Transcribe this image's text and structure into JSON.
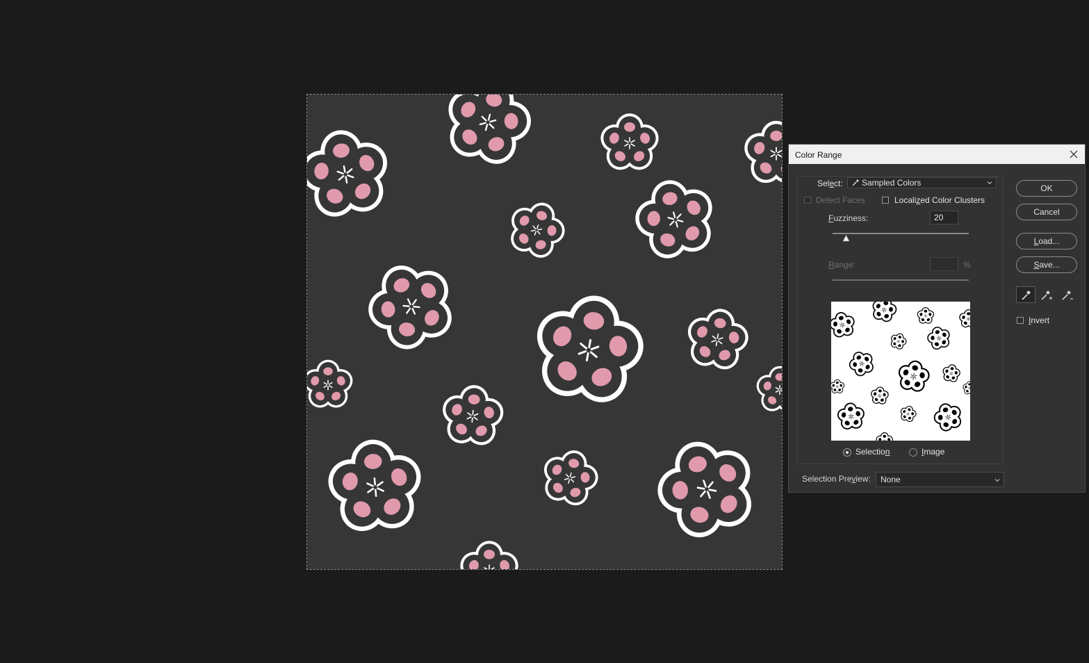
{
  "dialog": {
    "title": "Color Range",
    "select_label_pre": "Sel",
    "select_label_key": "e",
    "select_label_post": "ct:",
    "select_value": "Sampled Colors",
    "detect_faces": "Detect Faces",
    "localized_pre": "Locali",
    "localized_key": "z",
    "localized_post": "ed Color Clusters",
    "fuzziness_key": "F",
    "fuzziness_rest": "uzziness:",
    "fuzziness_value": "20",
    "range_key": "R",
    "range_rest": "ange:",
    "range_unit": "%",
    "radio_selection_pre": "Selectio",
    "radio_selection_key": "n",
    "radio_image_key": "I",
    "radio_image_rest": "mage",
    "preview_pre": "Selection Pre",
    "preview_key": "v",
    "preview_post": "iew:",
    "preview_value": "None",
    "ok": "OK",
    "cancel": "Cancel",
    "load_key": "L",
    "load_rest": "oad...",
    "save_key": "S",
    "save_rest": "ave...",
    "invert_key": "I",
    "invert_rest": "nvert"
  },
  "state": {
    "fuzziness_slider_fraction": 0.1,
    "selected_radio": "Selection",
    "active_eyedropper": "eyedropper-icon",
    "detect_faces_enabled": false,
    "localized_checked": false,
    "invert_checked": false
  },
  "icons": [
    "close-icon",
    "eyedropper-icon",
    "eyedropper-plus-icon",
    "eyedropper-minus-icon",
    "chevron-down-icon"
  ],
  "colors": {
    "canvas_bg": "#363636",
    "petal_pink": "#e09aac",
    "outline_white": "#ffffff",
    "dialog_bg": "#323232"
  }
}
